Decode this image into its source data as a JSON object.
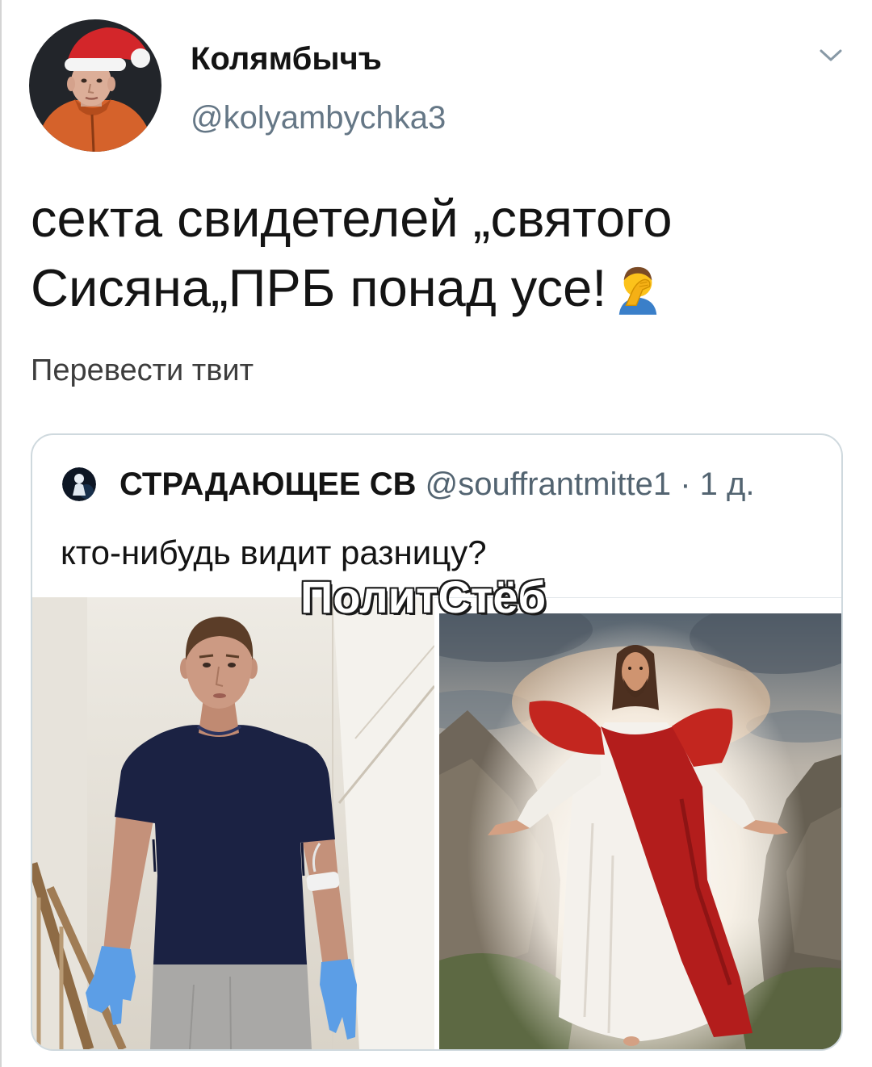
{
  "tweet": {
    "author": {
      "name": "Колямбычъ",
      "handle": "@kolyambychka3"
    },
    "more_menu_icon": "chevron-down-icon",
    "text_lines": [
      "секта свидетелей „святого",
      "Сисяна„ПРБ понад усе!"
    ],
    "emoji_icon": "man-facepalming-emoji-icon",
    "translate_label": "Перевести твит"
  },
  "quoted_tweet": {
    "author": {
      "name": "СТРАДАЮЩЕЕ СВ",
      "handle": "@souffrantmitte1",
      "separator": "·",
      "time": "1 д."
    },
    "text": "кто-нибудь видит разницу?"
  },
  "watermark": "ПолитСтёб",
  "colors": {
    "text_primary": "#141414",
    "text_secondary": "#657786",
    "meta": "#536471",
    "translate": "#3d3d3d",
    "border": "#cfd9de",
    "background": "#ffffff"
  }
}
